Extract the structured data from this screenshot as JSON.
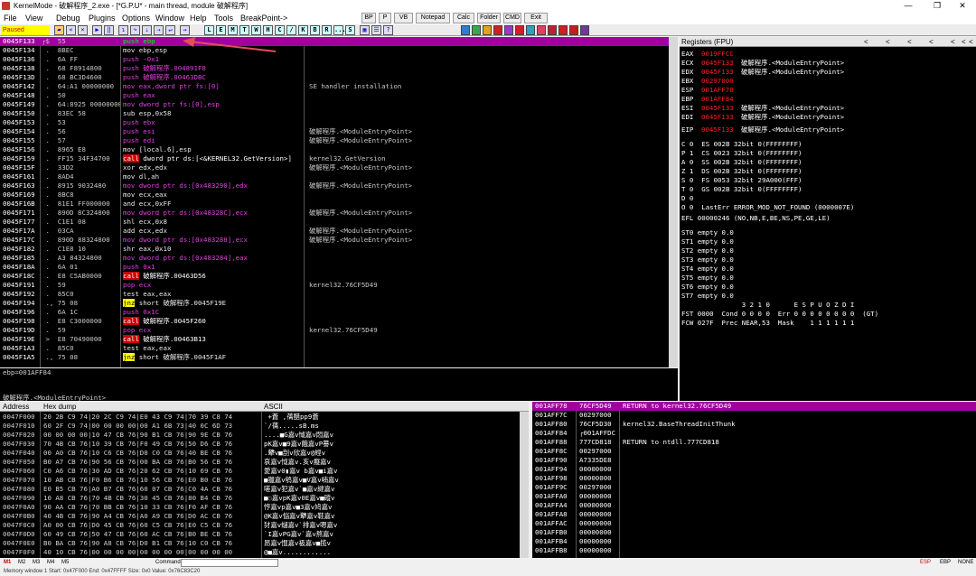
{
  "window": {
    "title": "KernelMode - 破解程序_2.exe - [*G.P.U* - main thread, module 破解程序]",
    "controls": [
      "—",
      "❐",
      "✕"
    ]
  },
  "menu": {
    "items": [
      "File",
      "View",
      "Debug",
      "Plugins",
      "Options",
      "Window",
      "Help",
      "Tools",
      "BreakPoint->"
    ],
    "extra": [
      "BP",
      "P",
      "VB",
      "Notepad",
      "Calc",
      "Folder",
      "CMD",
      "Exit"
    ]
  },
  "toolbar": {
    "status": "Paused",
    "letters": [
      "L",
      "E",
      "M",
      "T",
      "W",
      "H",
      "C",
      "/",
      "K",
      "B",
      "R",
      "...",
      "S"
    ]
  },
  "disasm": {
    "rows": [
      {
        "a": "0045F133",
        "h": "┌$  55",
        "m": "push ebp",
        "c": "",
        "sel": true
      },
      {
        "a": "0045F134",
        "h": " .  8BEC",
        "m": "mov ebp,esp",
        "c": ""
      },
      {
        "a": "0045F136",
        "h": " .  6A FF",
        "m": "push -0x1",
        "c": ""
      },
      {
        "a": "0045F138",
        "h": " .  68 F8914800",
        "m": "push 破解程序.004891F8",
        "c": ""
      },
      {
        "a": "0045F13D",
        "h": " .  68 BC3D4600",
        "m": "push 破解程序.00463DBC",
        "c": ""
      },
      {
        "a": "0045F142",
        "h": " .  64:A1 00000000",
        "m": "mov eax,dword ptr fs:[0]",
        "c": "SE handler installation"
      },
      {
        "a": "0045F148",
        "h": " .  50",
        "m": "push eax",
        "c": ""
      },
      {
        "a": "0045F149",
        "h": " .  64:8925 00000000",
        "m": "mov dword ptr fs:[0],esp",
        "c": ""
      },
      {
        "a": "0045F150",
        "h": " .  83EC 58",
        "m": "sub esp,0x58",
        "c": ""
      },
      {
        "a": "0045F153",
        "h": " .  53",
        "m": "push ebx",
        "c": ""
      },
      {
        "a": "0045F154",
        "h": " .  56",
        "m": "push esi",
        "c": "破解程序.<ModuleEntryPoint>"
      },
      {
        "a": "0045F155",
        "h": " .  57",
        "m": "push edi",
        "c": "破解程序.<ModuleEntryPoint>"
      },
      {
        "a": "0045F156",
        "h": " .  8965 E8",
        "m": "mov [local.6],esp",
        "c": ""
      },
      {
        "a": "0045F159",
        "h": " .  FF15 34F34700",
        "m": "call dword ptr ds:[<&KERNEL32.GetVersion>]",
        "c": "kernel32.GetVersion"
      },
      {
        "a": "0045F15F",
        "h": " .  33D2",
        "m": "xor edx,edx",
        "c": "破解程序.<ModuleEntryPoint>"
      },
      {
        "a": "0045F161",
        "h": " .  8AD4",
        "m": "mov dl,ah",
        "c": ""
      },
      {
        "a": "0045F163",
        "h": " .  8915 9032480",
        "m": "mov dword ptr ds:[0x483290],edx",
        "c": "破解程序.<ModuleEntryPoint>"
      },
      {
        "a": "0045F169",
        "h": " .  8BC8",
        "m": "mov ecx,eax",
        "c": ""
      },
      {
        "a": "0045F16B",
        "h": " .  81E1 FF000000",
        "m": "and ecx,0xFF",
        "c": ""
      },
      {
        "a": "0045F171",
        "h": " .  890D 8C324800",
        "m": "mov dword ptr ds:[0x48328C],ecx",
        "c": "破解程序.<ModuleEntryPoint>"
      },
      {
        "a": "0045F177",
        "h": " .  C1E1 08",
        "m": "shl ecx,0x8",
        "c": ""
      },
      {
        "a": "0045F17A",
        "h": " .  03CA",
        "m": "add ecx,edx",
        "c": "破解程序.<ModuleEntryPoint>"
      },
      {
        "a": "0045F17C",
        "h": " .  890D 88324800",
        "m": "mov dword ptr ds:[0x483288],ecx",
        "c": "破解程序.<ModuleEntryPoint>"
      },
      {
        "a": "0045F182",
        "h": " .  C1E8 10",
        "m": "shr eax,0x10",
        "c": ""
      },
      {
        "a": "0045F185",
        "h": " .  A3 84324800",
        "m": "mov dword ptr ds:[0x483284],eax",
        "c": ""
      },
      {
        "a": "0045F18A",
        "h": " .  6A 01",
        "m": "push 0x1",
        "c": ""
      },
      {
        "a": "0045F18C",
        "h": " .  E8 C5AB0000",
        "m": "call 破解程序.00463D56",
        "c": ""
      },
      {
        "a": "0045F191",
        "h": " .  59",
        "m": "pop ecx",
        "c": "kernel32.76CF5D49"
      },
      {
        "a": "0045F192",
        "h": " .  85C0",
        "m": "test eax,eax",
        "c": ""
      },
      {
        "a": "0045F194",
        "h": " ., 75 08",
        "m": "jnz short 破解程序.0045F19E",
        "c": ""
      },
      {
        "a": "0045F196",
        "h": " .  6A 1C",
        "m": "push 0x1C",
        "c": ""
      },
      {
        "a": "0045F198",
        "h": " .  E8 C3000000",
        "m": "call 破解程序.0045F260",
        "c": ""
      },
      {
        "a": "0045F19D",
        "h": " .  59",
        "m": "pop ecx",
        "c": "kernel32.76CF5D49"
      },
      {
        "a": "0045F19E",
        "h": " >  E8 70490000",
        "m": "call 破解程序.00463B13",
        "c": ""
      },
      {
        "a": "0045F1A3",
        "h": " .  85C0",
        "m": "test eax,eax",
        "c": ""
      },
      {
        "a": "0045F1A5",
        "h": " ., 75 08",
        "m": "jnz short 破解程序.0045F1AF",
        "c": ""
      }
    ],
    "info1": "ebp=001AFF84",
    "info2": "破解程序.<ModuleEntryPoint>"
  },
  "registers": {
    "title": "Registers (FPU)",
    "nav": [
      "<",
      "<",
      "<",
      "<",
      "<",
      "<",
      "<"
    ],
    "gp": [
      {
        "n": "EAX",
        "v": "0019FFCC",
        "c": ""
      },
      {
        "n": "ECX",
        "v": "0045F133",
        "c": "破解程序.<ModuleEntryPoint>"
      },
      {
        "n": "EDX",
        "v": "0045F133",
        "c": "破解程序.<ModuleEntryPoint>"
      },
      {
        "n": "EBX",
        "v": "00297000",
        "c": ""
      },
      {
        "n": "ESP",
        "v": "001AFF78",
        "c": ""
      },
      {
        "n": "EBP",
        "v": "001AFF84",
        "c": ""
      },
      {
        "n": "ESI",
        "v": "0045F133",
        "c": "破解程序.<ModuleEntryPoint>"
      },
      {
        "n": "EDI",
        "v": "0045F133",
        "c": "破解程序.<ModuleEntryPoint>"
      }
    ],
    "eip": {
      "n": "EIP",
      "v": "0045F133",
      "c": "破解程序.<ModuleEntryPoint>"
    },
    "seg": [
      "C 0  ES 002B 32bit 0(FFFFFFFF)",
      "P 1  CS 0023 32bit 0(FFFFFFFF)",
      "A 0  SS 002B 32bit 0(FFFFFFFF)",
      "Z 1  DS 002B 32bit 0(FFFFFFFF)",
      "S 0  FS 0053 32bit 29A000(FFF)",
      "T 0  GS 002B 32bit 0(FFFFFFFF)",
      "D 0",
      "O 0  LastErr ERROR_MOD_NOT_FOUND (0000007E)"
    ],
    "efl": "EFL 00000246 (NO,NB,E,BE,NS,PE,GE,LE)",
    "fpu": [
      "ST0 empty 0.0",
      "ST1 empty 0.0",
      "ST2 empty 0.0",
      "ST3 empty 0.0",
      "ST4 empty 0.0",
      "ST5 empty 0.0",
      "ST6 empty 0.0",
      "ST7 empty 0.0"
    ],
    "fstbits": "               3 2 1 0      E S P U O Z D I",
    "fst": "FST 0000  Cond 0 0 0 0  Err 0 0 0 0 0 0 0 0  (GT)",
    "fcw": "FCW 027F  Prec NEAR,53  Mask    1 1 1 1 1 1"
  },
  "dump": {
    "headers": [
      "Address",
      "Hex dump",
      "ASCII"
    ],
    "rows": [
      {
        "a": "0047F000",
        "h": "20 2B C9 74|20 2C C9 74|E0 43 C9 74|70 39 C8 74",
        "s": " +蒼 ,蒨醋pp9蒼"
      },
      {
        "a": "0047F010",
        "h": "60 2F C9 74|00 00 00 00|00 A1 6B 73|40 0C 6D 73",
        "s": "`/蒨.....sB.ms"
      },
      {
        "a": "0047F020",
        "h": "00 00 00 00|10 47 CB 76|90 B1 CB 76|90 9E CB 76",
        "s": "....■G嘉v惐嘉v悶嘉v"
      },
      {
        "a": "0047F030",
        "h": "70 4B CB 76|10 39 CB 76|F0 49 CB 76|50 D6 CB 76",
        "s": "pK嘉v■9嘉v餓嘉vP謩v"
      },
      {
        "a": "0047F040",
        "h": "00 A0 CB 76|10 C6 CB 76|D0 C0 CB 76|40 BE CB 76",
        "s": ".犩v■剖v欣嘉v@經v"
      },
      {
        "a": "0047F050",
        "h": "B0 A7 CB 76|90 56 CB 76|00 BA CB 76|B0 56 CB 76",
        "s": "哀嘉v怴嘉v.亥v癡嘉v"
      },
      {
        "a": "0047F060",
        "h": "C0 A6 CB 76|30 AD CB 76|20 62 CB 76|10 69 CB 76",
        "s": "愛嘉v0▮嘉v b嘉v■i嘉v"
      },
      {
        "a": "0047F070",
        "h": "10 AB CB 76|F0 B6 CB 76|10 56 CB 76|E0 B0 CB 76",
        "s": "■獵嘉v鸲嘉v■V嘉v喃嘉v"
      },
      {
        "a": "0047F080",
        "h": "E0 B5 CB 76|A0 B7 CB 76|60 07 CB 76|C0 4A CB 76",
        "s": "嗟嘉v犯嘉v`■嘉v繨嘉v"
      },
      {
        "a": "0047F090",
        "h": "10 A8 CB 76|70 4B CB 76|30 45 CB 76|80 B4 CB 76",
        "s": "■◌嘉vpK嘉v0E嘉v■磫v"
      },
      {
        "a": "0047F0A0",
        "h": "90 AA CB 76|70 BB CB 76|10 33 CB 76|F0 AF CB 76",
        "s": "悙嘉vp嘉v■3嘉v鸠嘉v"
      },
      {
        "a": "0047F0B0",
        "h": "40 4B CB 76|90 A4 CB 76|A0 A9 CB 76|D0 AC CB 76",
        "s": "@K嘉v悩嘉v犩嘉v鞋嘉v"
      },
      {
        "a": "0047F0C0",
        "h": "A0 00 CB 76|D0 45 CB 76|60 C5 CB 76|E0 C5 CB 76",
        "s": "犲嘉v蠩嘉v`排嘉v嗯嘉v"
      },
      {
        "a": "0047F0D0",
        "h": "60 49 CB 76|50 47 CB 76|60 AC CB 76|B0 BE CB 76",
        "s": "`I嘉vPG嘉v`嘉v熬嘉v"
      },
      {
        "a": "0047F0E0",
        "h": "B0 BA CB 76|90 A8 CB 76|D0 B1 CB 76|10 C0 CB 76",
        "s": "昂嘉v惃嘉v衱嘉v■揽v"
      },
      {
        "a": "0047F0F0",
        "h": "40 10 CB 76|00 00 00 00|00 00 00 00|00 00 00 00",
        "s": "@■嘉v............"
      }
    ]
  },
  "stack": {
    "rows": [
      {
        "a": "001AFF78",
        "v": "76CF5D49",
        "c": "RETURN to kernel32.76CF5D49",
        "sel": true
      },
      {
        "a": "001AFF7C",
        "v": "00297000",
        "c": ""
      },
      {
        "a": "001AFF80",
        "v": "76CF5D30",
        "c": "kernel32.BaseThreadInitThunk"
      },
      {
        "a": "001AFF84",
        "v": "┌001AFFDC",
        "c": ""
      },
      {
        "a": "001AFF88",
        "v": "777CD818",
        "c": "RETURN to ntdll.777CD818"
      },
      {
        "a": "001AFF8C",
        "v": "00297000",
        "c": ""
      },
      {
        "a": "001AFF90",
        "v": "A7335DE8",
        "c": ""
      },
      {
        "a": "001AFF94",
        "v": "00000000",
        "c": ""
      },
      {
        "a": "001AFF98",
        "v": "00000000",
        "c": ""
      },
      {
        "a": "001AFF9C",
        "v": "00297000",
        "c": ""
      },
      {
        "a": "001AFFA0",
        "v": "00000000",
        "c": ""
      },
      {
        "a": "001AFFA4",
        "v": "00000000",
        "c": ""
      },
      {
        "a": "001AFFA8",
        "v": "00000000",
        "c": ""
      },
      {
        "a": "001AFFAC",
        "v": "00000000",
        "c": ""
      },
      {
        "a": "001AFFB0",
        "v": "00000000",
        "c": ""
      },
      {
        "a": "001AFFB4",
        "v": "00000000",
        "c": ""
      },
      {
        "a": "001AFFB8",
        "v": "00000000",
        "c": ""
      }
    ]
  },
  "bottom": {
    "tabs": [
      "M1",
      "M2",
      "M3",
      "M4",
      "M5"
    ],
    "command_label": "Command:",
    "right": [
      "ESP",
      "EBP",
      "NONE"
    ],
    "statusline": "Memory window 1 Start: 0x47F000 End: 0x47FFFF Size: 0x0 Value: 0x76C83C20"
  }
}
